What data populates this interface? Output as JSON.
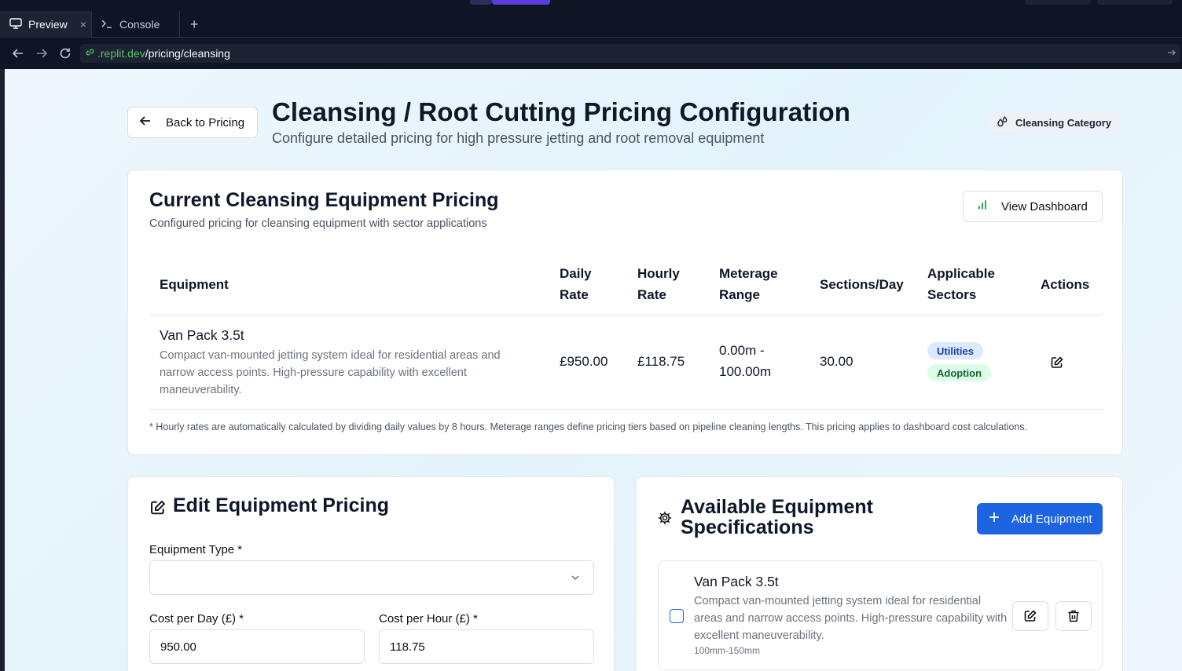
{
  "browser": {
    "tabs": [
      {
        "label": "Preview",
        "close": "×"
      },
      {
        "label": "Console"
      }
    ],
    "new_tab": "+",
    "url_host": ".replit.dev",
    "url_path": "/pricing/cleansing"
  },
  "header": {
    "back_label": "Back to Pricing",
    "title": "Cleansing / Root Cutting Pricing Configuration",
    "subtitle": "Configure detailed pricing for high pressure jetting and root removal equipment",
    "category_badge": "Cleansing Category"
  },
  "current_pricing": {
    "title": "Current Cleansing Equipment Pricing",
    "description": "Configured pricing for cleansing equipment with sector applications",
    "dashboard_button": "View Dashboard",
    "columns": {
      "equipment": "Equipment",
      "daily_rate_1": "Daily",
      "daily_rate_2": "Rate",
      "hourly_rate_1": "Hourly",
      "hourly_rate_2": "Rate",
      "meterage_1": "Meterage",
      "meterage_2": "Range",
      "sections": "Sections/Day",
      "sectors_1": "Applicable",
      "sectors_2": "Sectors",
      "actions": "Actions"
    },
    "rows": [
      {
        "name": "Van Pack 3.5t",
        "description": "Compact van-mounted jetting system ideal for residential areas and narrow access points. High-pressure capability with excellent maneuverability.",
        "daily_rate": "£950.00",
        "hourly_rate": "£118.75",
        "meterage_1": "0.00m -",
        "meterage_2": "100.00m",
        "sections_per_day": "30.00",
        "sectors": [
          "Utilities",
          "Adoption"
        ]
      }
    ],
    "footnote": "* Hourly rates are automatically calculated by dividing daily values by 8 hours. Meterage ranges define pricing tiers based on pipeline cleaning lengths. This pricing applies to dashboard cost calculations."
  },
  "edit_form": {
    "title": "Edit Equipment Pricing",
    "equipment_type_label": "Equipment Type *",
    "equipment_type_value": "",
    "cost_per_day_label": "Cost per Day (£) *",
    "cost_per_day_value": "950.00",
    "cost_per_hour_label": "Cost per Hour (£) *",
    "cost_per_hour_value": "118.75"
  },
  "specs": {
    "title": "Available Equipment Specifications",
    "add_button": "Add Equipment",
    "items": [
      {
        "name": "Van Pack 3.5t",
        "description": "Compact van-mounted jetting system ideal for residential areas and narrow access points. High-pressure capability with excellent maneuverability.",
        "size": "100mm-150mm"
      }
    ]
  },
  "colors": {
    "accent": "#1d64e2",
    "utilities_badge": "#dbeafe",
    "adoption_badge": "#dcfce7",
    "url_host": "#58c16b"
  }
}
